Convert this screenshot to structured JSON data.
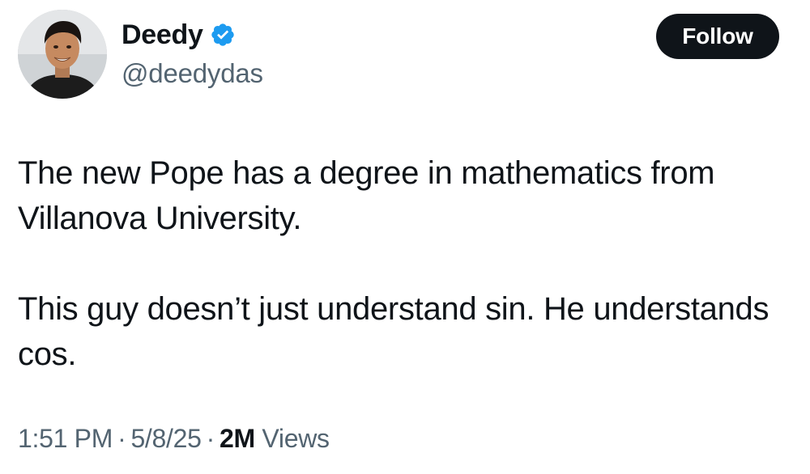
{
  "author": {
    "display_name": "Deedy",
    "handle": "@deedydas",
    "avatar_icon": "user-avatar-icon",
    "verified_icon": "verified-badge-icon",
    "verified_color": "#1d9bf0"
  },
  "follow_button": {
    "label": "Follow"
  },
  "tweet": {
    "paragraph_1": "The new Pope has a degree in mathematics from Villanova University.",
    "paragraph_2": "This guy doesn’t just understand sin. He understands cos."
  },
  "meta": {
    "time": "1:51 PM",
    "separator": "·",
    "date": "5/8/25",
    "views_count": "2M",
    "views_label": "Views"
  },
  "colors": {
    "text_primary": "#0f1419",
    "text_secondary": "#536471",
    "button_bg": "#0f1419",
    "button_text": "#ffffff"
  }
}
